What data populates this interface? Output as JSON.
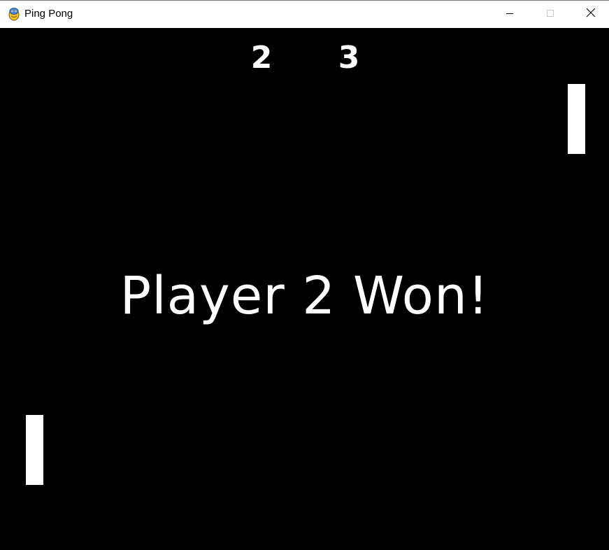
{
  "window": {
    "title": "Ping Pong",
    "app_icon": "pygame-snake-icon",
    "controls": {
      "minimize_icon": "minimize-icon",
      "maximize_icon": "maximize-icon",
      "close_icon": "close-icon"
    }
  },
  "game": {
    "background_color": "#000000",
    "foreground_color": "#ffffff",
    "scores": {
      "player1": "2",
      "player2": "3"
    },
    "message": "Player 2 Won!"
  }
}
